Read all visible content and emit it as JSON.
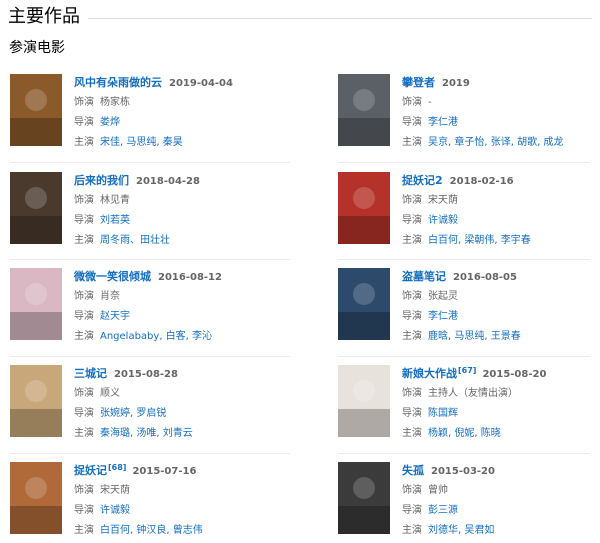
{
  "section": {
    "title": "主要作品"
  },
  "subsection": {
    "title": "参演电影"
  },
  "labels": {
    "role": "饰演",
    "director": "导演",
    "cast": "主演"
  },
  "films": [
    {
      "title": "风中有朵雨做的云",
      "ref": "",
      "date": "2019-04-04",
      "role": "杨家栋",
      "director": "娄烨",
      "cast": "宋佳, 马思纯, 秦昊",
      "poster_color": "#8a5a2b"
    },
    {
      "title": "攀登者",
      "ref": "",
      "date": "2019",
      "role": "-",
      "director": "李仁港",
      "cast": "吴京, 章子怡, 张译, 胡歌, 成龙",
      "poster_color": "#5b5f66"
    },
    {
      "title": "后来的我们",
      "ref": "",
      "date": "2018-04-28",
      "role": "林见青",
      "director": "刘若英",
      "cast": "周冬雨、田壮壮",
      "poster_color": "#4a3a2e"
    },
    {
      "title": "捉妖记2",
      "ref": "",
      "date": "2018-02-16",
      "role": "宋天荫",
      "director": "许诚毅",
      "cast": "白百何, 梁朝伟, 李宇春",
      "poster_color": "#b5322a"
    },
    {
      "title": "微微一笑很倾城",
      "ref": "",
      "date": "2016-08-12",
      "role": "肖奈",
      "director": "赵天宇",
      "cast": "Angelababy, 白客, 李沁",
      "poster_color": "#d9b8c4"
    },
    {
      "title": "盗墓笔记",
      "ref": "",
      "date": "2016-08-05",
      "role": "张起灵",
      "director": "李仁港",
      "cast": "鹿晗, 马思纯, 王景春",
      "poster_color": "#2d4a6b"
    },
    {
      "title": "三城记",
      "ref": "",
      "date": "2015-08-28",
      "role": "顺义",
      "director": "张婉婷, 罗启锐",
      "cast": "秦海璐, 汤唯, 刘青云",
      "poster_color": "#c8a87a"
    },
    {
      "title": "新娘大作战",
      "ref": "[67]",
      "date": "2015-08-20",
      "role": "主持人（友情出演）",
      "director": "陈国辉",
      "cast": "杨颖, 倪妮, 陈晓",
      "poster_color": "#e8e2dc"
    },
    {
      "title": "捉妖记",
      "ref": "[68]",
      "date": "2015-07-16",
      "role": "宋天荫",
      "director": "许诚毅",
      "cast": "白百何, 钟汉良, 曾志伟",
      "poster_color": "#b06a3a"
    },
    {
      "title": "失孤",
      "ref": "",
      "date": "2015-03-20",
      "role": "曾帅",
      "director": "彭三源",
      "cast": "刘德华, 吴君如",
      "poster_color": "#3b3b3b"
    }
  ]
}
